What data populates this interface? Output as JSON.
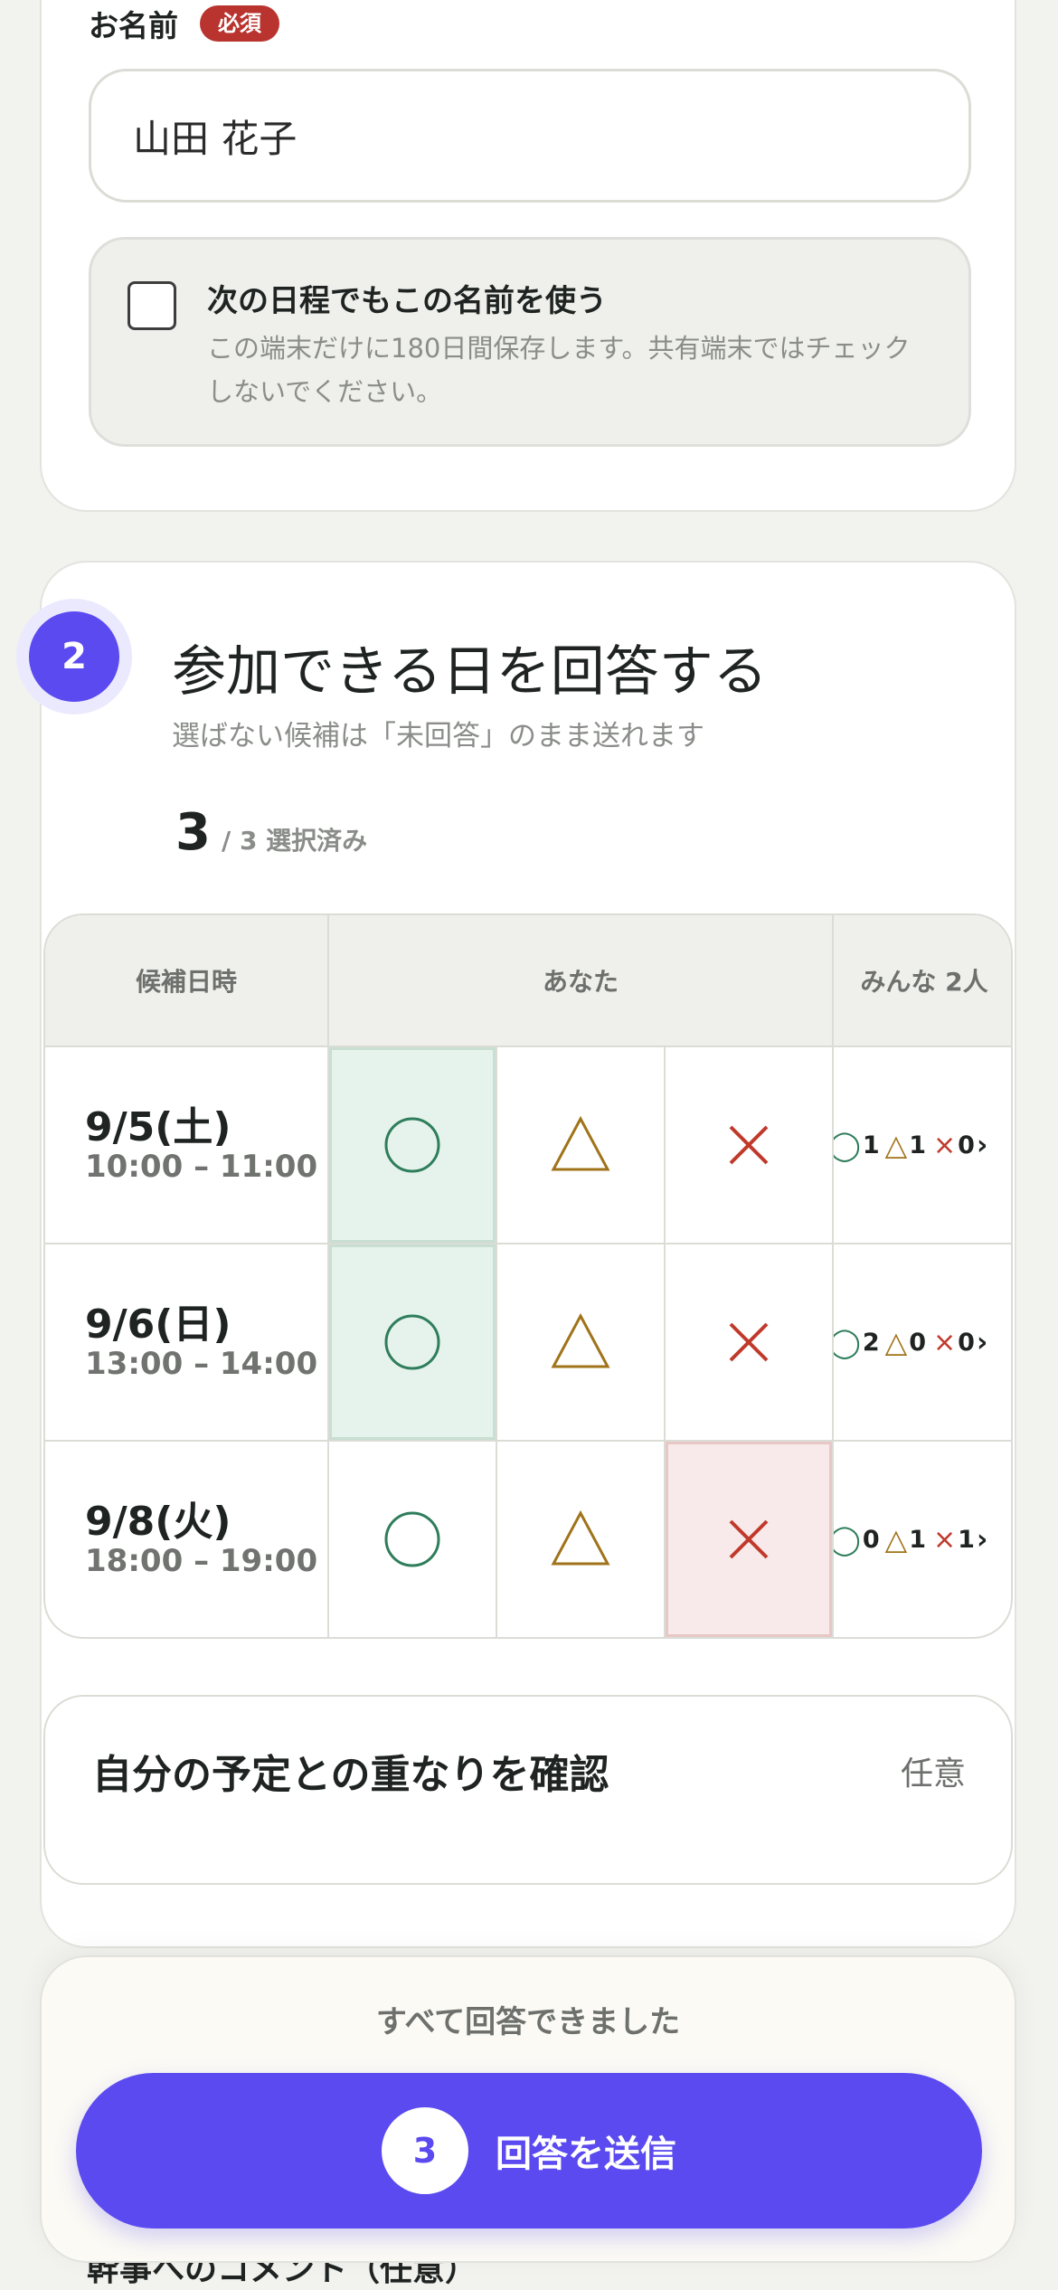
{
  "name_section": {
    "label": "お名前",
    "required_badge": "必須",
    "name_value": "山田 花子",
    "remember_title": "次の日程でもこの名前を使う",
    "remember_desc": "この端末だけに180日間保存します。共有端末ではチェックしないでください。",
    "remember_checked": false
  },
  "availability": {
    "step_number": "2",
    "title": "参加できる日を回答する",
    "subtitle": "選ばない候補は「未回答」のまま送れます",
    "selected_count": "3",
    "selected_rest": "/ 3 選択済み",
    "headers": {
      "date": "候補日時",
      "you": "あなた",
      "everyone": "みんな 2人"
    },
    "rows": [
      {
        "date": "9/5(土)",
        "time": "10:00 – 11:00",
        "selected": "yes",
        "yes": "1",
        "maybe": "1",
        "no": "0"
      },
      {
        "date": "9/6(日)",
        "time": "13:00 – 14:00",
        "selected": "yes",
        "yes": "2",
        "maybe": "0",
        "no": "0"
      },
      {
        "date": "9/8(火)",
        "time": "18:00 – 19:00",
        "selected": "no",
        "yes": "0",
        "maybe": "1",
        "no": "1"
      }
    ],
    "symbols": {
      "yes": "◯",
      "maybe": "△",
      "no": "×",
      "chevron": "›"
    }
  },
  "overlap": {
    "title": "自分の予定との重なりを確認",
    "optional": "任意"
  },
  "footer": {
    "status": "すべて回答できました",
    "submit_count": "3",
    "submit_label": "回答を送信"
  },
  "next_section": {
    "label": "幹事へのコメント（任意）"
  },
  "colors": {
    "accent": "#5a4af0",
    "yes": "#2e7d5b",
    "maybe": "#a0731a",
    "no": "#c0392b"
  }
}
